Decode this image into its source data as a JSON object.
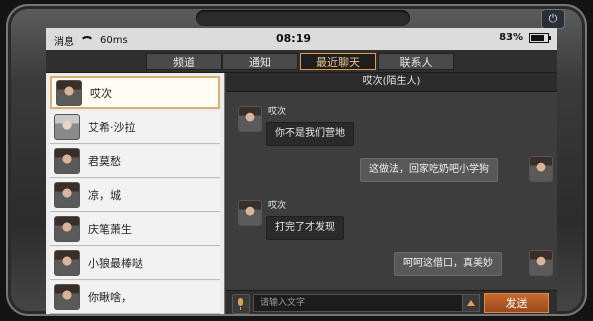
{
  "power_icon": "power-icon",
  "status_bar": {
    "carrier": "消息",
    "signal": "60ms",
    "time": "08:19",
    "battery": "83%"
  },
  "tabs": [
    {
      "label": "频道",
      "active": false
    },
    {
      "label": "通知",
      "active": false
    },
    {
      "label": "最近聊天",
      "active": true
    },
    {
      "label": "联系人",
      "active": false
    }
  ],
  "contacts": [
    {
      "name": "哎次",
      "selected": true
    },
    {
      "name": "艾希·沙拉",
      "selected": false
    },
    {
      "name": "君莫愁",
      "selected": false
    },
    {
      "name": "凉，城",
      "selected": false
    },
    {
      "name": "庆笔萧生",
      "selected": false
    },
    {
      "name": "小狼最棒哒",
      "selected": false
    },
    {
      "name": "你瞅啥，",
      "selected": false
    }
  ],
  "chat": {
    "title": "哎次(陌生人)",
    "messages": [
      {
        "side": "left",
        "sender": "哎次",
        "text": "你不是我们营地"
      },
      {
        "side": "right",
        "text": "这做法，回家吃奶吧小学狗"
      },
      {
        "side": "left",
        "sender": "哎次",
        "text": "打完了才发现"
      },
      {
        "side": "right",
        "text": "呵呵这借口，真美妙"
      }
    ]
  },
  "input": {
    "placeholder": "请输入文字",
    "send_label": "发送"
  },
  "colors": {
    "accent": "#e39a4a",
    "send": "#b85e27"
  }
}
